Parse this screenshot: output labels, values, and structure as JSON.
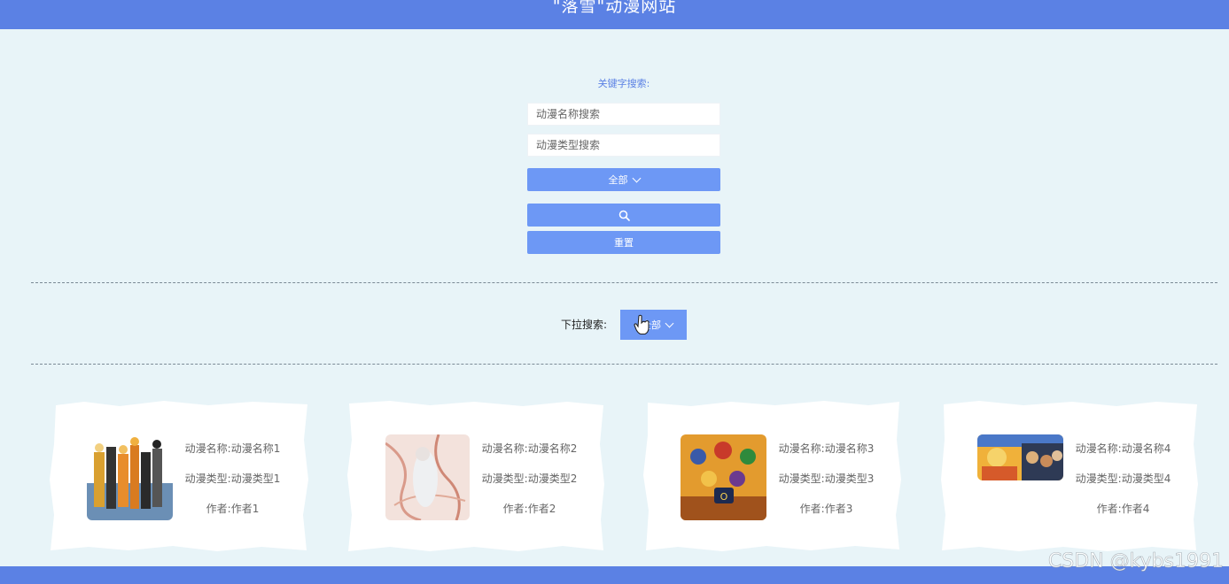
{
  "header": {
    "title": "\"落雪\"动漫网站"
  },
  "search": {
    "label": "关键字搜索:",
    "name_placeholder": "动漫名称搜索",
    "type_placeholder": "动漫类型搜索",
    "filter_label": "全部",
    "reset_label": "重置"
  },
  "dropdown": {
    "label": "下拉搜索:",
    "button_label": "全部"
  },
  "cards": [
    {
      "name": "动漫名称:动漫名称1",
      "type": "动漫类型:动漫类型1",
      "author": "作者:作者1"
    },
    {
      "name": "动漫名称:动漫名称2",
      "type": "动漫类型:动漫类型2",
      "author": "作者:作者2"
    },
    {
      "name": "动漫名称:动漫名称3",
      "type": "动漫类型:动漫类型3",
      "author": "作者:作者3"
    },
    {
      "name": "动漫名称:动漫名称4",
      "type": "动漫类型:动漫类型4",
      "author": "作者:作者4"
    }
  ],
  "watermark": "CSDN @kybs1991",
  "colors": {
    "primary": "#5b81e4",
    "button": "#6d98f5",
    "background": "#e8f4f8"
  }
}
